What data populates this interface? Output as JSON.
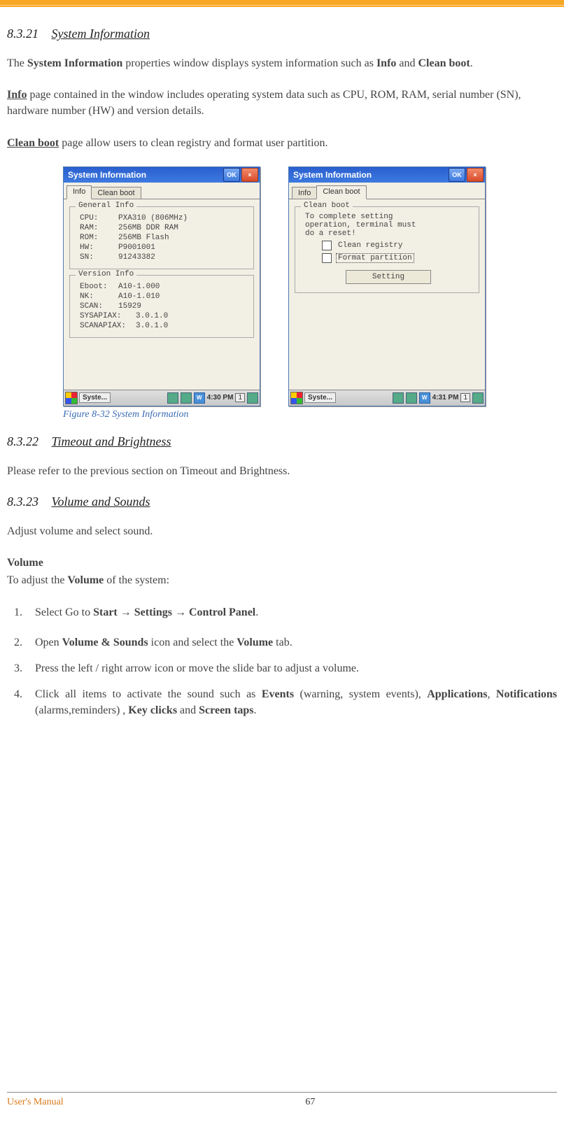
{
  "sections": {
    "s1": {
      "num": "8.3.21",
      "title": "System Information"
    },
    "s2": {
      "num": "8.3.22",
      "title": "Timeout and Brightness"
    },
    "s3": {
      "num": "8.3.23",
      "title": "Volume and Sounds"
    }
  },
  "para": {
    "p1a": "The ",
    "p1b": "System Information",
    "p1c": " properties window displays system information such as ",
    "p1d": "Info",
    "p1e": " and ",
    "p1f": "Clean boot",
    "p1g": ".",
    "p2a": "Info",
    "p2b": " page contained in the window includes operating system data such as CPU, ROM, RAM, serial number (SN), hardware number (HW) and version details.",
    "p3a": "Clean boot",
    "p3b": " page allow users to clean registry and format user partition.",
    "p4": "Please refer to the previous section on Timeout and Brightness.",
    "p5": "Adjust volume and select sound.",
    "p6": "Volume",
    "p7a": "To adjust the ",
    "p7b": "Volume",
    "p7c": " of the system:"
  },
  "steps": {
    "s1a": "Select Go to ",
    "s1b": "Start",
    "s1arrow1": " → ",
    "s1c": " Settings",
    "s1arrow2": " → ",
    "s1d": " Control Panel",
    "s1e": ".",
    "s2a": "Open  ",
    "s2b": "Volume & Sounds",
    "s2c": " icon and select the ",
    "s2d": "Volume",
    "s2e": " tab.",
    "s3": "Press the left / right arrow icon or move the slide bar to adjust a volume.",
    "s4a": "Click all items to activate the sound such as ",
    "s4b": "Events",
    "s4c": " (warning, system events), ",
    "s4d": "Applications",
    "s4e": ", ",
    "s4f": "Notifications",
    "s4g": " (alarms,reminders) , ",
    "s4h": "Key clicks",
    "s4i": " and ",
    "s4j": "Screen taps",
    "s4k": "."
  },
  "figure_caption": "Figure 8-32 System Information",
  "win1": {
    "title": "System Information",
    "ok": "OK",
    "close": "×",
    "tab_info": "Info",
    "tab_clean": "Clean boot",
    "general_legend": "General Info",
    "cpu_k": "CPU:",
    "cpu_v": "PXA310 (806MHz)",
    "ram_k": "RAM:",
    "ram_v": "256MB DDR RAM",
    "rom_k": "ROM:",
    "rom_v": "256MB Flash",
    "hw_k": "HW:",
    "hw_v": "P9001001",
    "sn_k": "SN:",
    "sn_v": "91243382",
    "version_legend": "Version Info",
    "eboot_k": "Eboot:",
    "eboot_v": "A10-1.000",
    "nk_k": "NK:",
    "nk_v": "A10-1.010",
    "scan_k": "SCAN:",
    "scan_v": "15929",
    "sysapiax_k": "SYSAPIAX:",
    "sysapiax_v": "3.0.1.0",
    "scanapiax_k": "SCANAPIAX:",
    "scanapiax_v": "3.0.1.0",
    "task": "Syste...",
    "time": "4:30 PM",
    "kbd": "1",
    "w": "W"
  },
  "win2": {
    "title": "System Information",
    "ok": "OK",
    "close": "×",
    "tab_info": "Info",
    "tab_clean": "Clean boot",
    "legend": "Clean boot",
    "msg1": "To complete setting",
    "msg2": "operation, terminal must",
    "msg3": "do a reset!",
    "cb1": "Clean registry",
    "cb2": "Format partition",
    "btn": "Setting",
    "task": "Syste...",
    "time": "4:31 PM",
    "kbd": "1",
    "w": "W"
  },
  "footer": {
    "left": "User's Manual",
    "page": "67"
  }
}
